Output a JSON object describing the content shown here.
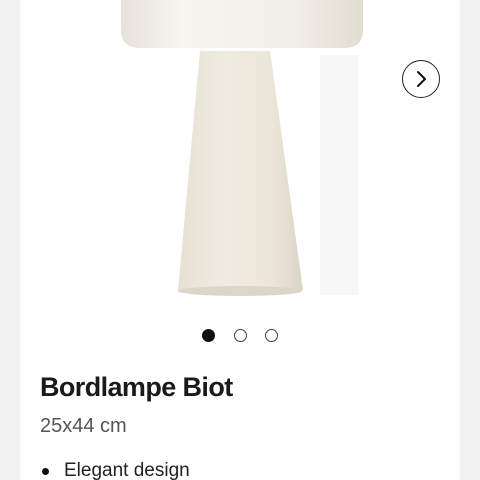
{
  "gallery": {
    "image_alt": "Bordlampe Biot",
    "next_icon": "chevron-right-icon",
    "slide_count": 3,
    "active_slide": 1
  },
  "product": {
    "title": "Bordlampe Biot",
    "dimensions": "25x44 cm",
    "features": [
      "Elegant design"
    ]
  },
  "colors": {
    "lamp": "#efeae0",
    "shade": "#f4f2ec",
    "background": "#f1f1f1",
    "card": "#ffffff"
  }
}
